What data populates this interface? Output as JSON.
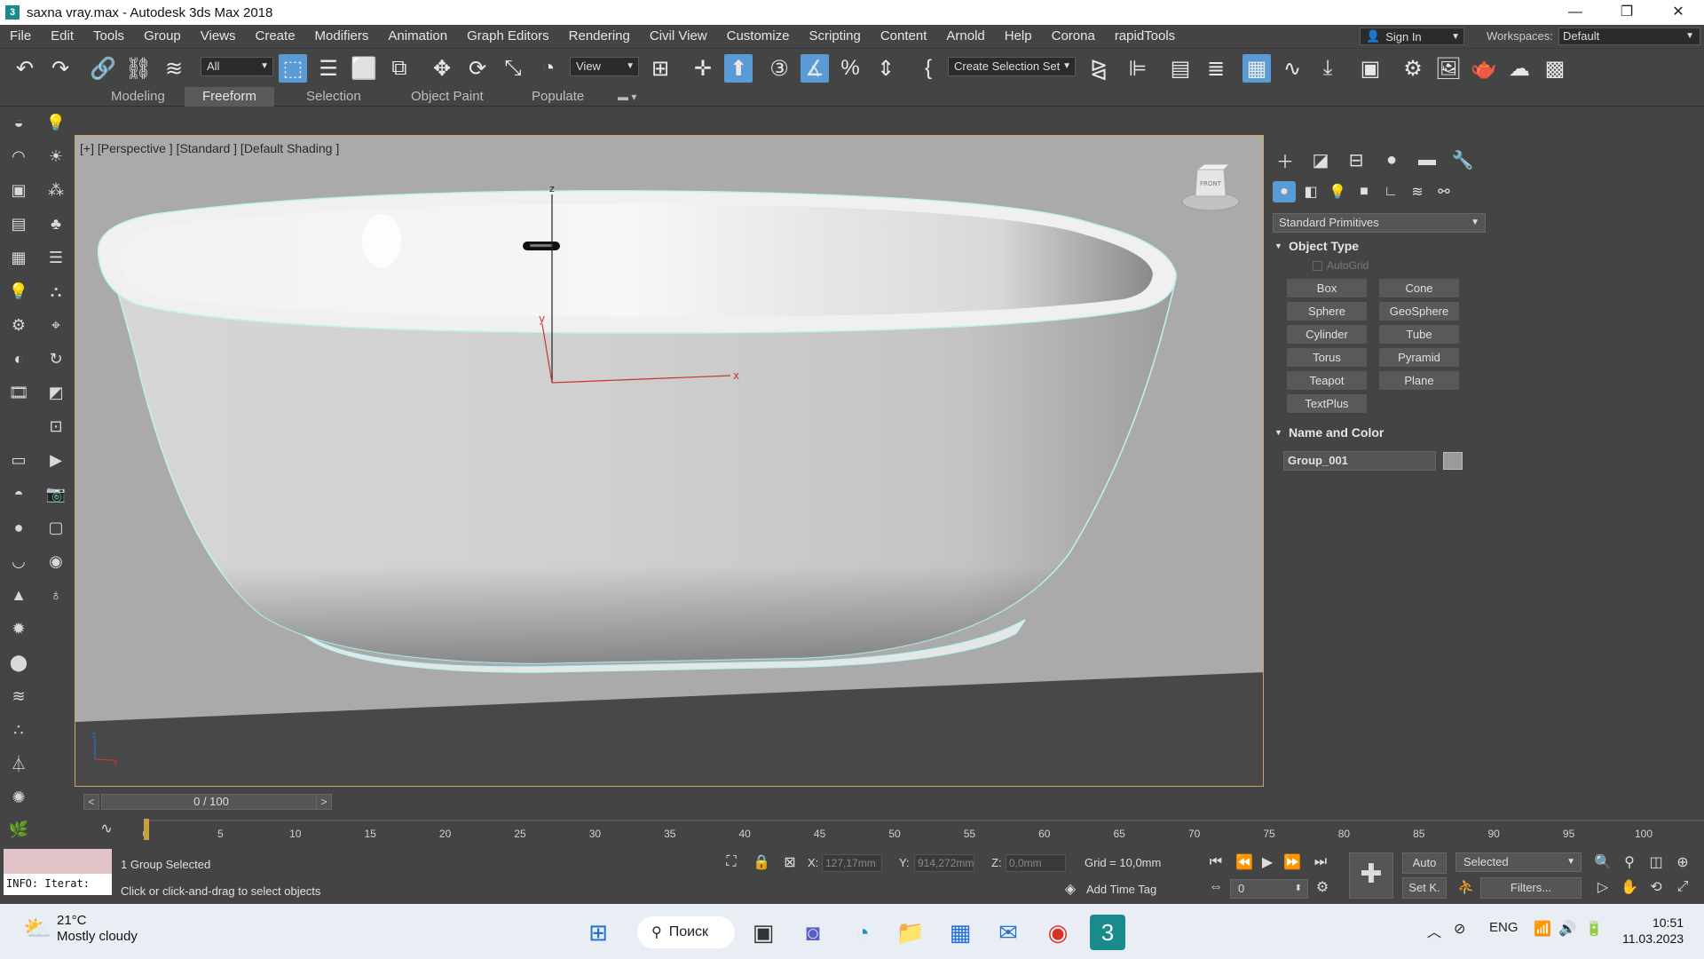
{
  "window": {
    "title": "saxna vray.max - Autodesk 3ds Max 2018",
    "app_icon": "3",
    "minimize": "—",
    "restore": "❐",
    "close": "✕"
  },
  "menu": [
    "File",
    "Edit",
    "Tools",
    "Group",
    "Views",
    "Create",
    "Modifiers",
    "Animation",
    "Graph Editors",
    "Rendering",
    "Civil View",
    "Customize",
    "Scripting",
    "Content",
    "Arnold",
    "Help",
    "Corona",
    "rapidTools"
  ],
  "account": {
    "sign_in": "Sign In",
    "workspaces_label": "Workspaces:",
    "workspace_value": "Default"
  },
  "toolbar": {
    "filter_value": "All",
    "ref_coord_value": "View",
    "selection_set_value": "Create Selection Set"
  },
  "ribbon_tabs": [
    "Modeling",
    "Freeform",
    "Selection",
    "Object Paint",
    "Populate"
  ],
  "ribbon_active": "Freeform",
  "viewport": {
    "label": "[+] [Perspective ] [Standard ] [Default Shading ]",
    "viewcube_label": "FRONT",
    "gizmo_x": "x",
    "gizmo_y": "y",
    "gizmo_z": "z"
  },
  "command_panel": {
    "category_value": "Standard Primitives",
    "object_type_title": "Object Type",
    "autogrid": "AutoGrid",
    "primitives": [
      "Box",
      "Cone",
      "Sphere",
      "GeoSphere",
      "Cylinder",
      "Tube",
      "Torus",
      "Pyramid",
      "Teapot",
      "Plane",
      "TextPlus"
    ],
    "name_color_title": "Name and Color",
    "object_name": "Group_001",
    "object_color": "#9a9a9a"
  },
  "timeline": {
    "frame_display": "0 / 100",
    "ticks": [
      "0",
      "5",
      "10",
      "15",
      "20",
      "25",
      "30",
      "35",
      "40",
      "45",
      "50",
      "55",
      "60",
      "65",
      "70",
      "75",
      "80",
      "85",
      "90",
      "95",
      "100"
    ]
  },
  "status": {
    "maxscript_text": "INFO: Iterat:",
    "selection": "1 Group Selected",
    "prompt": "Click or click-and-drag to select objects",
    "x_label": "X:",
    "x_value": "127,17mm",
    "y_label": "Y:",
    "y_value": "914,272mm",
    "z_label": "Z:",
    "z_value": "0,0mm",
    "grid": "Grid = 10,0mm",
    "add_time_tag": "Add Time Tag",
    "auto_key": "Auto",
    "key_mode_value": "Selected",
    "set_key": "Set K.",
    "filters": "Filters...",
    "current_frame": "0"
  },
  "taskbar": {
    "temperature": "21°C",
    "weather": "Mostly cloudy",
    "search": "Поиск",
    "language": "ENG",
    "time": "10:51",
    "date": "11.03.2023"
  }
}
